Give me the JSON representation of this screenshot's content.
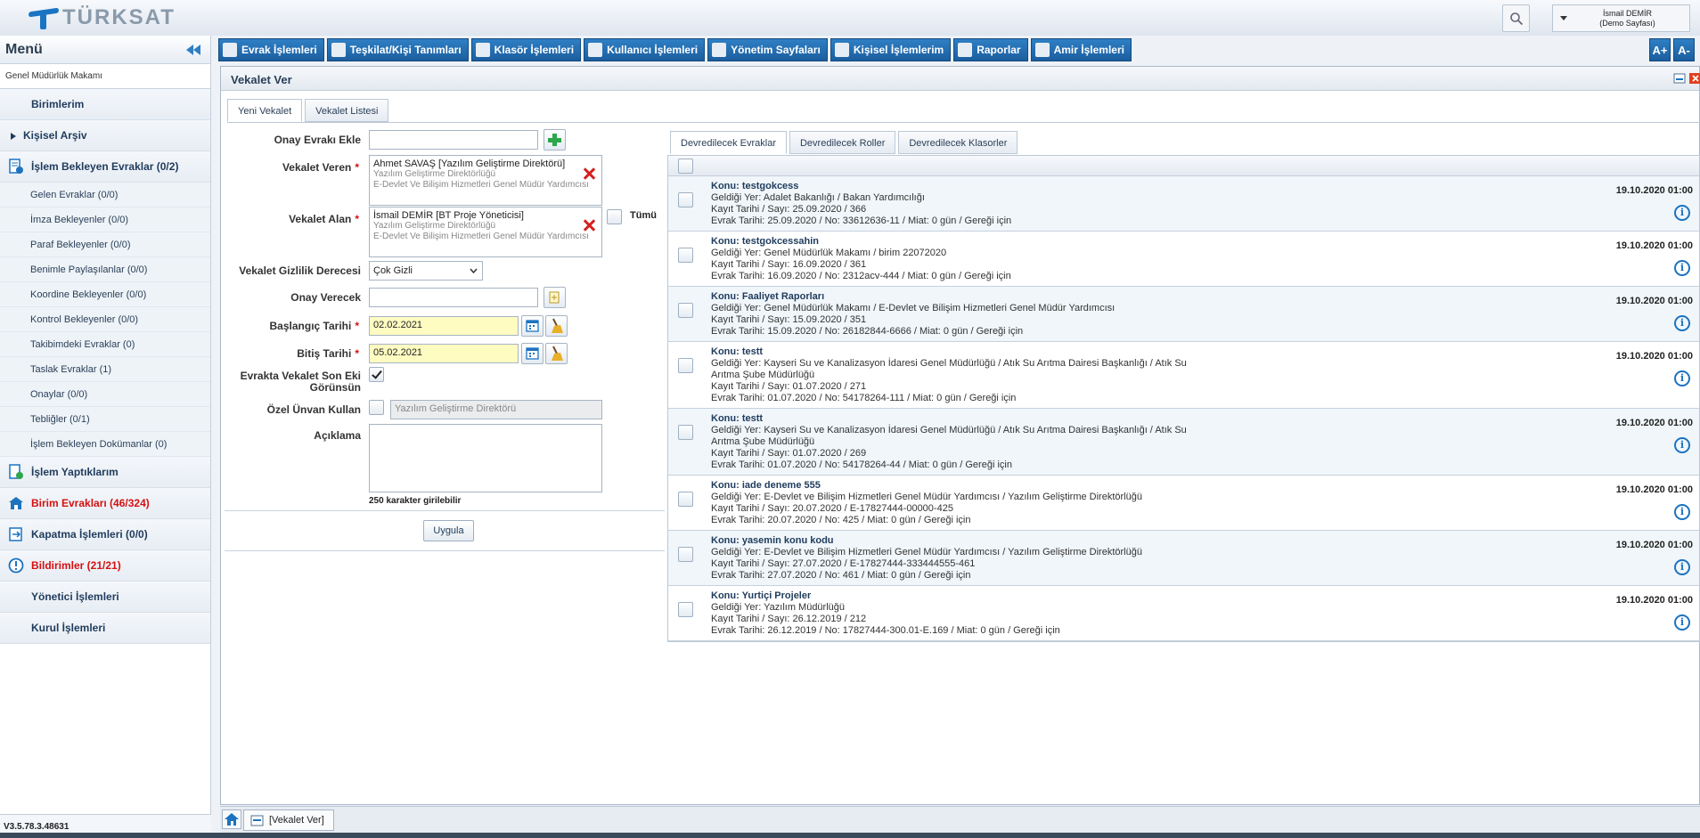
{
  "header": {
    "brand": "TÜRKSAT",
    "user_name": "İsmail DEMİR",
    "user_sub": "(Demo Sayfası)"
  },
  "sidebar": {
    "title": "Menü",
    "crumb": "Genel Müdürlük Makamı",
    "items": [
      {
        "label": "Birimlerim"
      },
      {
        "label": "Kişisel Arşiv"
      },
      {
        "label": "İşlem Bekleyen Evraklar (0/2)"
      },
      {
        "label": "İşlem Yaptıklarım"
      },
      {
        "label": "Birim Evrakları (46/324)"
      },
      {
        "label": "Kapatma İşlemleri (0/0)"
      },
      {
        "label": "Bildirimler (21/21)"
      },
      {
        "label": "Yönetici İşlemleri"
      },
      {
        "label": "Kurul İşlemleri"
      }
    ],
    "subitems": [
      "Gelen Evraklar (0/0)",
      "İmza Bekleyenler (0/0)",
      "Paraf Bekleyenler (0/0)",
      "Benimle Paylaşılanlar (0/0)",
      "Koordine Bekleyenler (0/0)",
      "Kontrol Bekleyenler (0/0)",
      "Takibimdeki Evraklar (0)",
      "Taslak Evraklar (1)",
      "Onaylar (0/0)",
      "Tebliğler (0/1)",
      "İşlem Bekleyen Dokümanlar (0)"
    ],
    "version": "V3.5.78.3.48631"
  },
  "nav": [
    "Evrak İşlemleri",
    "Teşkilat/Kişi Tanımları",
    "Klasör İşlemleri",
    "Kullanıcı İşlemleri",
    "Yönetim Sayfaları",
    "Kişisel İşlemlerim",
    "Raporlar",
    "Amir İşlemleri"
  ],
  "font_buttons": [
    "A+",
    "A-"
  ],
  "main": {
    "title": "Vekalet Ver",
    "tabs": [
      "Yeni Vekalet",
      "Vekalet Listesi"
    ],
    "form": {
      "onay_evraki_label": "Onay Evrakı Ekle",
      "vekalet_veren_label": "Vekalet Veren",
      "vekalet_veren_name": "Ahmet SAVAŞ [Yazılım Geliştirme Direktörü]",
      "vekalet_veren_sub1": "Yazılım Geliştirme Direktörlüğü",
      "vekalet_veren_sub2": "E-Devlet Ve Bilişim Hizmetleri Genel Müdür Yardımcısı",
      "vekalet_alan_label": "Vekalet Alan",
      "vekalet_alan_name": "İsmail DEMİR [BT Proje Yöneticisi]",
      "vekalet_alan_sub1": "Yazılım Geliştirme Direktörlüğü",
      "vekalet_alan_sub2": "E-Devlet Ve Bilişim Hizmetleri Genel Müdür Yardımcısı",
      "tumu_label": "Tümü",
      "gizlilik_label": "Vekalet Gizlilik Derecesi",
      "gizlilik_value": "Çok Gizli",
      "onay_verecek_label": "Onay Verecek",
      "baslangic_label": "Başlangıç Tarihi",
      "baslangic_value": "02.02.2021",
      "bitis_label": "Bitiş Tarihi",
      "bitis_value": "05.02.2021",
      "son_ek_label_1": "Evrakta Vekalet Son Eki",
      "son_ek_label_2": "Görünsün",
      "ozel_unvan_label": "Özel Ünvan Kullan",
      "ozel_unvan_placeholder": "Yazılım Geliştirme Direktörü",
      "aciklama_label": "Açıklama",
      "char_hint": "250 karakter girilebilir",
      "apply": "Uygula"
    },
    "right_tabs": [
      "Devredilecek Evraklar",
      "Devredilecek Roller",
      "Devredilecek Klasorler"
    ],
    "documents": [
      {
        "konu": "Konu: testgokcess",
        "geldigi": "Geldiği Yer: Adalet Bakanlığı / Bakan Yardımcılığı",
        "kayit": "Kayıt Tarihi / Sayı: 25.09.2020 / 366",
        "evrak": "Evrak Tarihi: 25.09.2020 / No: 33612636-11 / Miat: 0 gün / Gereği için",
        "date": "19.10.2020 01:00"
      },
      {
        "konu": "Konu: testgokcessahin",
        "geldigi": "Geldiği Yer: Genel Müdürlük Makamı / birim 22072020",
        "kayit": "Kayıt Tarihi / Sayı: 16.09.2020 / 361",
        "evrak": "Evrak Tarihi: 16.09.2020 / No: 2312acv-444 / Miat: 0 gün / Gereği için",
        "date": "19.10.2020 01:00"
      },
      {
        "konu": "Konu: Faaliyet Raporları",
        "geldigi": "Geldiği Yer: Genel Müdürlük Makamı / E-Devlet ve Bilişim Hizmetleri Genel Müdür Yardımcısı",
        "kayit": "Kayıt Tarihi / Sayı: 15.09.2020 / 351",
        "evrak": "Evrak Tarihi: 15.09.2020 / No: 26182844-6666 / Miat: 0 gün / Gereği için",
        "date": "19.10.2020 01:00"
      },
      {
        "konu": "Konu: testt",
        "geldigi": "Geldiği Yer: Kayseri Su ve Kanalizasyon İdaresi Genel Müdürlüğü / Atık Su Arıtma Dairesi Başkanlığı / Atık Su Arıtma Şube Müdürlüğü",
        "kayit": "Kayıt Tarihi / Sayı: 01.07.2020 / 271",
        "evrak": "Evrak Tarihi: 01.07.2020 / No: 54178264-111 / Miat: 0 gün / Gereği için",
        "date": "19.10.2020 01:00"
      },
      {
        "konu": "Konu: testt",
        "geldigi": "Geldiği Yer: Kayseri Su ve Kanalizasyon İdaresi Genel Müdürlüğü / Atık Su Arıtma Dairesi Başkanlığı / Atık Su Arıtma Şube Müdürlüğü",
        "kayit": "Kayıt Tarihi / Sayı: 01.07.2020 / 269",
        "evrak": "Evrak Tarihi: 01.07.2020 / No: 54178264-44 / Miat: 0 gün / Gereği için",
        "date": "19.10.2020 01:00"
      },
      {
        "konu": "Konu: iade deneme 555",
        "geldigi": "Geldiği Yer: E-Devlet ve Bilişim Hizmetleri Genel Müdür Yardımcısı / Yazılım Geliştirme Direktörlüğü",
        "kayit": "Kayıt Tarihi / Sayı: 20.07.2020 / E-17827444-00000-425",
        "evrak": "Evrak Tarihi: 20.07.2020 / No: 425 / Miat: 0 gün / Gereği için",
        "date": "19.10.2020 01:00"
      },
      {
        "konu": "Konu: yasemin konu kodu",
        "geldigi": "Geldiği Yer: E-Devlet ve Bilişim Hizmetleri Genel Müdür Yardımcısı / Yazılım Geliştirme Direktörlüğü",
        "kayit": "Kayıt Tarihi / Sayı: 27.07.2020 / E-17827444-333444555-461",
        "evrak": "Evrak Tarihi: 27.07.2020 / No: 461 / Miat: 0 gün / Gereği için",
        "date": "19.10.2020 01:00"
      },
      {
        "konu": "Konu: Yurtiçi Projeler",
        "geldigi": "Geldiği Yer: Yazılım Müdürlüğü",
        "kayit": "Kayıt Tarihi / Sayı: 26.12.2019 / 212",
        "evrak": "Evrak Tarihi: 26.12.2019 / No: 17827444-300.01-E.169 / Miat: 0 gün / Gereği için",
        "date": "19.10.2020 01:00"
      }
    ]
  },
  "taskbar": {
    "tab": "[Vekalet Ver]"
  },
  "colors": {
    "accent": "#1b5e9f",
    "alert": "#d41111",
    "date_fill": "#fffcc2"
  }
}
